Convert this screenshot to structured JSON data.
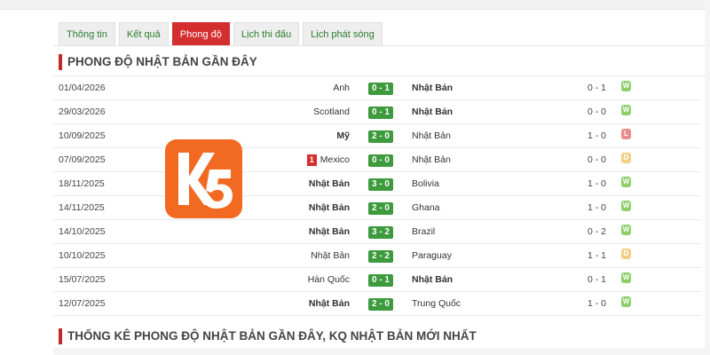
{
  "tabs": [
    {
      "label": "Thông tin",
      "active": false
    },
    {
      "label": "Kết quả",
      "active": false
    },
    {
      "label": "Phong độ",
      "active": true
    },
    {
      "label": "Lịch thi đấu",
      "active": false
    },
    {
      "label": "Lịch phát sóng",
      "active": false
    }
  ],
  "section1_title": "PHONG ĐỘ NHẬT BẢN GẦN ĐÂY",
  "section2_title": "THỐNG KÊ PHONG ĐỘ NHẬT BẢN GẦN ĐÂY, KQ NHẬT BẢN MỚI NHẤT",
  "logo_text": "K5",
  "colors": {
    "accent": "#d32f2f",
    "score": "#3d9a3d",
    "win": "#8ccf6b",
    "loss": "#ec8b8b",
    "draw": "#f2cf84",
    "logo": "#f26a21"
  },
  "matches": [
    {
      "date": "01/04/2026",
      "home": "Anh",
      "home_bold": false,
      "red_card": "",
      "score": "0 - 1",
      "away": "Nhật Bản",
      "away_bold": true,
      "ht": "0 - 1",
      "result": "W"
    },
    {
      "date": "29/03/2026",
      "home": "Scotland",
      "home_bold": false,
      "red_card": "",
      "score": "0 - 1",
      "away": "Nhật Bản",
      "away_bold": true,
      "ht": "0 - 0",
      "result": "W"
    },
    {
      "date": "10/09/2025",
      "home": "Mỹ",
      "home_bold": true,
      "red_card": "",
      "score": "2 - 0",
      "away": "Nhật Bản",
      "away_bold": false,
      "ht": "1 - 0",
      "result": "L"
    },
    {
      "date": "07/09/2025",
      "home": "Mexico",
      "home_bold": false,
      "red_card": "1",
      "score": "0 - 0",
      "away": "Nhật Bản",
      "away_bold": false,
      "ht": "0 - 0",
      "result": "D"
    },
    {
      "date": "18/11/2025",
      "home": "Nhật Bản",
      "home_bold": true,
      "red_card": "",
      "score": "3 - 0",
      "away": "Bolivia",
      "away_bold": false,
      "ht": "1 - 0",
      "result": "W"
    },
    {
      "date": "14/11/2025",
      "home": "Nhật Bản",
      "home_bold": true,
      "red_card": "",
      "score": "2 - 0",
      "away": "Ghana",
      "away_bold": false,
      "ht": "1 - 0",
      "result": "W"
    },
    {
      "date": "14/10/2025",
      "home": "Nhật Bản",
      "home_bold": true,
      "red_card": "",
      "score": "3 - 2",
      "away": "Brazil",
      "away_bold": false,
      "ht": "0 - 2",
      "result": "W"
    },
    {
      "date": "10/10/2025",
      "home": "Nhật Bản",
      "home_bold": false,
      "red_card": "",
      "score": "2 - 2",
      "away": "Paraguay",
      "away_bold": false,
      "ht": "1 - 1",
      "result": "D"
    },
    {
      "date": "15/07/2025",
      "home": "Hàn Quốc",
      "home_bold": false,
      "red_card": "",
      "score": "0 - 1",
      "away": "Nhật Bản",
      "away_bold": true,
      "ht": "0 - 1",
      "result": "W"
    },
    {
      "date": "12/07/2025",
      "home": "Nhật Bản",
      "home_bold": true,
      "red_card": "",
      "score": "2 - 0",
      "away": "Trung Quốc",
      "away_bold": false,
      "ht": "1 - 0",
      "result": "W"
    }
  ]
}
